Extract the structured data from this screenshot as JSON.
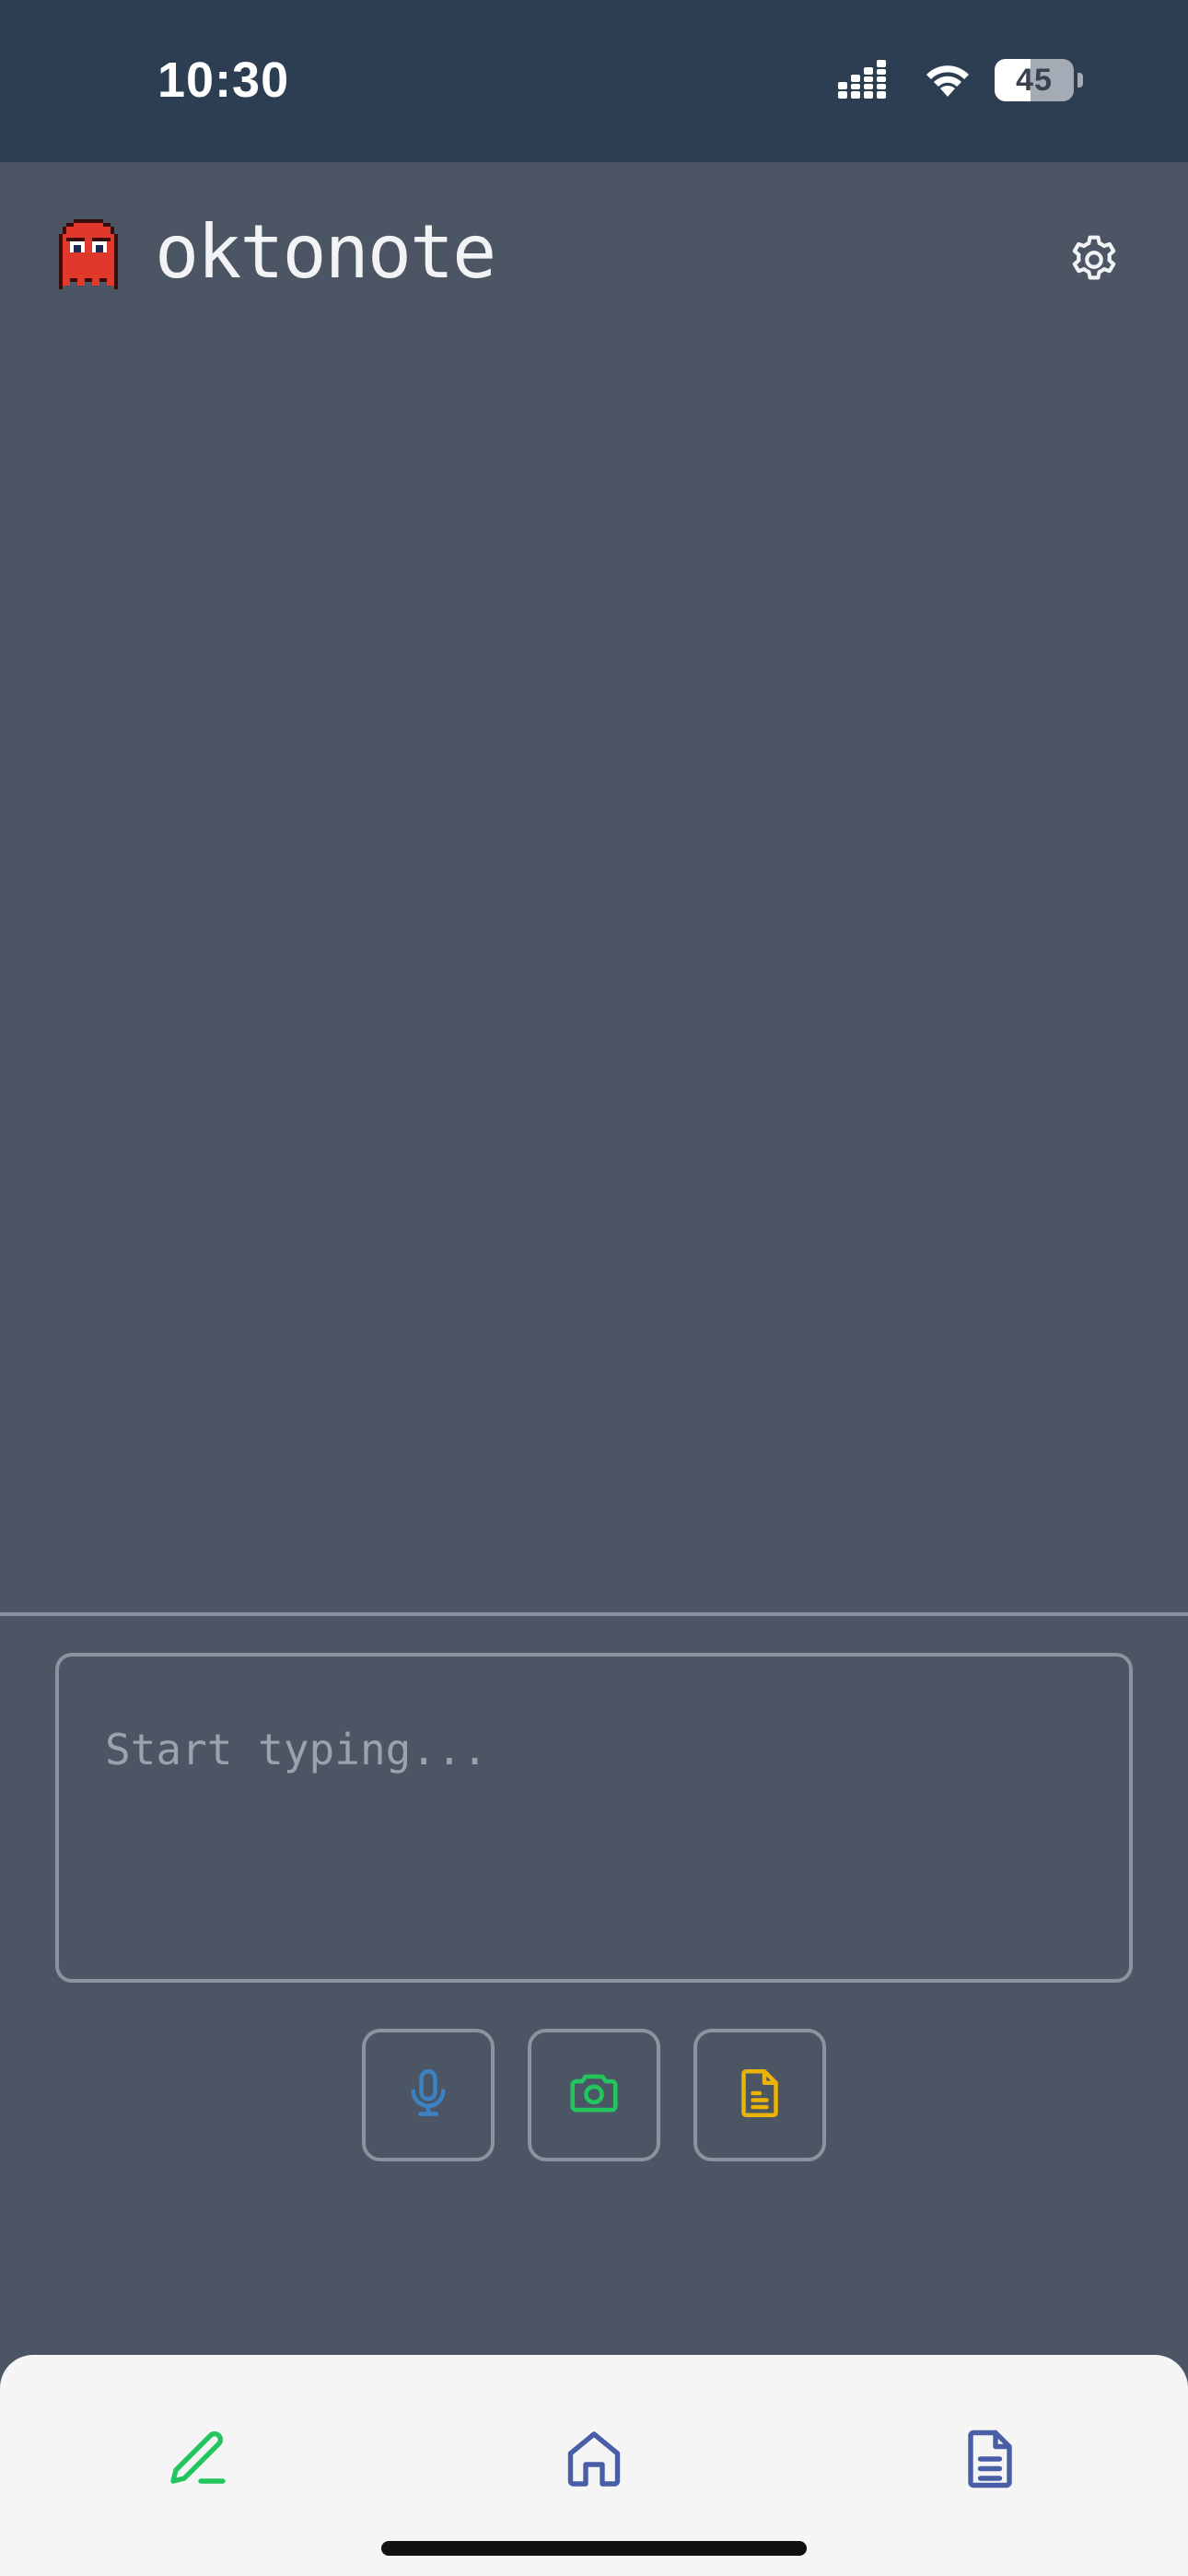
{
  "status_bar": {
    "time": "10:30",
    "battery_level": "45",
    "battery_fraction": 0.45,
    "icons": [
      "cellular-signal-icon",
      "wifi-icon",
      "battery-icon"
    ]
  },
  "header": {
    "app_name": "oktonote",
    "logo_icon": "red-ghost-icon",
    "settings_icon": "gear-icon"
  },
  "composer": {
    "placeholder": "Start typing...",
    "value": ""
  },
  "actions": [
    {
      "icon": "microphone-icon",
      "color": "#3b82c4"
    },
    {
      "icon": "camera-icon",
      "color": "#22c55e"
    },
    {
      "icon": "document-icon",
      "color": "#eab308"
    }
  ],
  "bottom_nav": [
    {
      "icon": "pencil-icon",
      "color": "#22c55e",
      "active": true
    },
    {
      "icon": "home-icon",
      "color": "#4a5ea8",
      "active": false
    },
    {
      "icon": "notes-list-icon",
      "color": "#4a5ea8",
      "active": false
    }
  ],
  "colors": {
    "background": "#4b5563",
    "status_bar": "#2d3d52",
    "border": "#8a939f",
    "nav_background": "#f5f5f5"
  }
}
